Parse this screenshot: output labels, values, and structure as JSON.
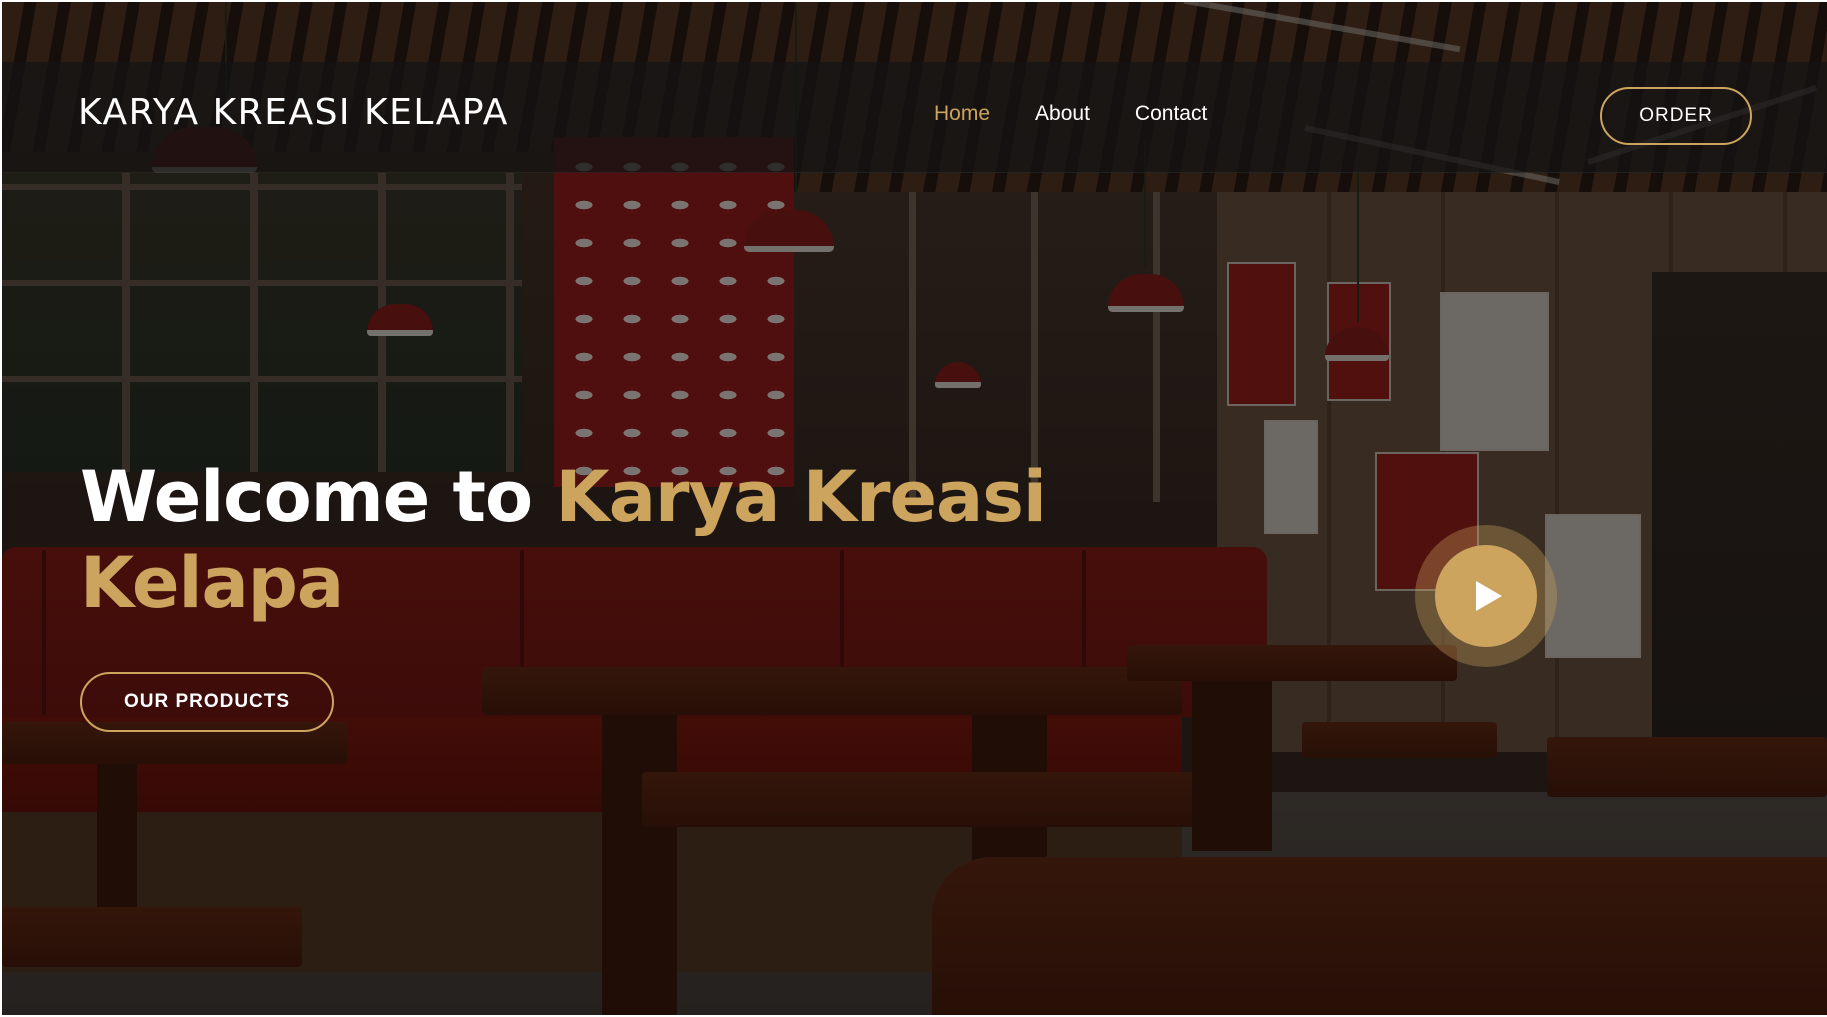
{
  "brand": {
    "name": "KARYA KREASI KELAPA"
  },
  "nav": {
    "links": [
      {
        "label": "Home",
        "active": true
      },
      {
        "label": "About",
        "active": false
      },
      {
        "label": "Contact",
        "active": false
      }
    ],
    "order_label": "ORDER"
  },
  "hero": {
    "title_lead": "Welcome to ",
    "title_highlight": "Karya Kreasi Kelapa",
    "cta_label": "OUR PRODUCTS",
    "play_icon": "play-icon"
  },
  "colors": {
    "accent": "#cda45e",
    "text": "#ffffff",
    "nav_background": "#141414"
  }
}
